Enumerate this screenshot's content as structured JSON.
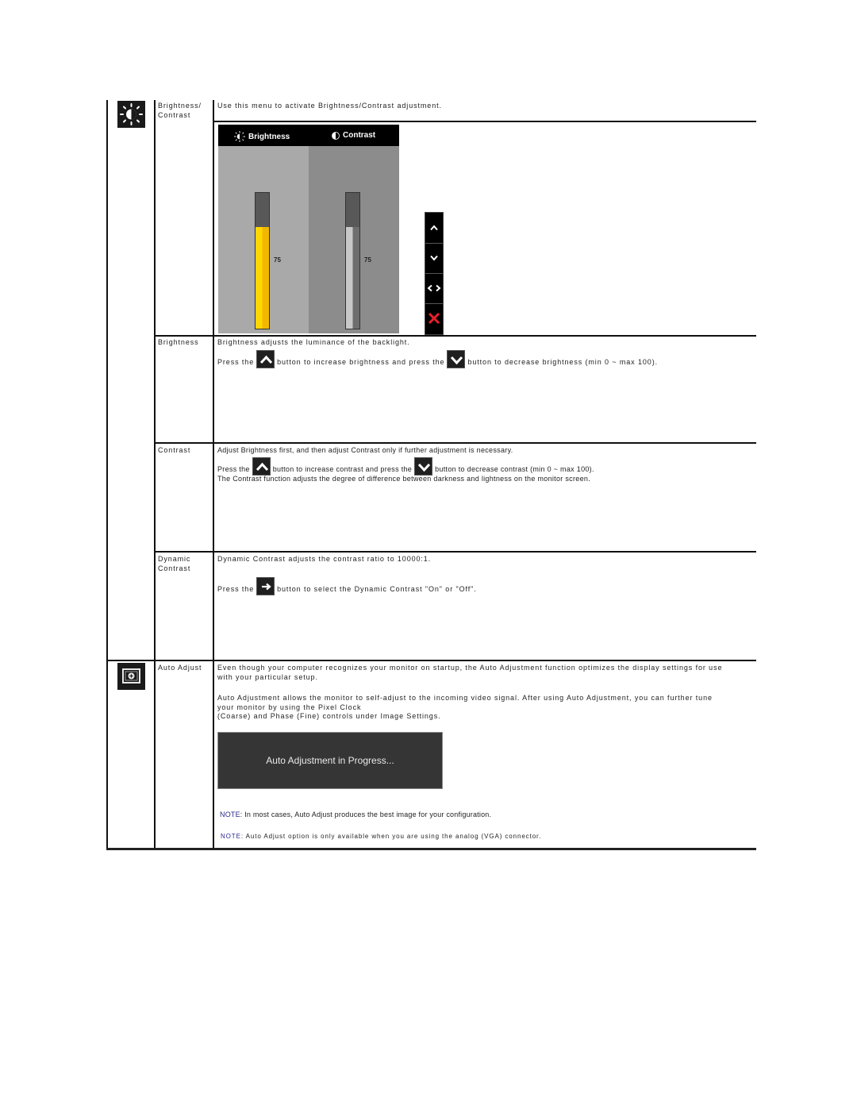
{
  "sections": {
    "brightness_contrast": {
      "icon": "brightness-contrast-icon",
      "label_line1": "Brightness/",
      "label_line2": "Contrast",
      "description": "Use this menu to activate Brightness/Contrast adjustment."
    },
    "osd": {
      "tab_brightness": "Brightness",
      "tab_contrast": "Contrast",
      "brightness_value": 75,
      "contrast_value": 75,
      "brightness_label": "75",
      "contrast_label": "75",
      "brightness_color": "#ffd700",
      "contrast_color": "#c8c8c8",
      "nav_buttons": [
        "up-icon",
        "down-icon",
        "left-right-icon",
        "close-icon"
      ]
    },
    "brightness": {
      "label": "Brightness",
      "line1": "Brightness adjusts the luminance of the backlight.",
      "press_the": "Press the",
      "middle": "button to increase brightness and press the",
      "end": "button to decrease brightness (min 0 ~  max 100)."
    },
    "contrast": {
      "label": "Contrast",
      "line1": "Adjust Brightness first, and then adjust Contrast only if further adjustment is necessary.",
      "press_the": "Press the",
      "middle": "button to increase contrast and press the",
      "end": "button to decrease contrast (min 0 ~  max 100).",
      "line3": "The Contrast function adjusts the degree of difference between darkness and lightness on the monitor screen."
    },
    "dynamic_contrast": {
      "label_line1": "Dynamic",
      "label_line2": "Contrast",
      "line1": "Dynamic Contrast adjusts the contrast ratio to 10000:1.",
      "press_the": "Press the",
      "end": "button to select the Dynamic Contrast \"On\" or \"Off\"."
    },
    "auto_adjust": {
      "icon": "auto-adjust-icon",
      "label": "Auto Adjust",
      "para1_line1": "Even though your computer recognizes your monitor on startup, the Auto Adjustment function optimizes the display settings for use",
      "para1_line2": "with your particular setup.",
      "para2_line1": "Auto Adjustment allows the monitor to self-adjust to the incoming video signal. After using Auto Adjustment, you can further tune",
      "para2_line2": "your monitor by using the Pixel Clock",
      "para2_line3": "(Coarse) and Phase (Fine) controls under Image Settings.",
      "progress_text": "Auto Adjustment  in Progress...",
      "note1_label": "NOTE:",
      "note1_text": " In most cases, Auto Adjust produces the best image for your configuration.",
      "note2_label": "NOTE:",
      "note2_text": " Auto Adjust option is only available when you are using the analog (VGA) connector."
    }
  },
  "colors": {
    "note_label": "#2a2a8a",
    "close_red": "#e8202a"
  }
}
